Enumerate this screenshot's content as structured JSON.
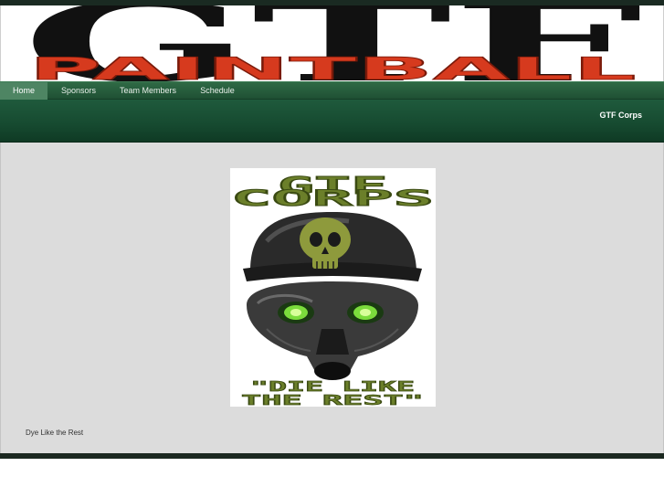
{
  "banner": {
    "title": "GTF",
    "subtitle": "PAINTBALL"
  },
  "nav": {
    "items": [
      {
        "label": "Home",
        "active": true
      },
      {
        "label": "Sponsors",
        "active": false
      },
      {
        "label": "Team Members",
        "active": false
      },
      {
        "label": "Schedule",
        "active": false
      }
    ]
  },
  "header": {
    "site_title": "GTF Corps"
  },
  "poster": {
    "line1": "GTF",
    "line2": "CORPS",
    "slogan_line1": "\"DIE LIKE",
    "slogan_line2": "THE REST\""
  },
  "content": {
    "caption": "Dye Like the Rest"
  },
  "colors": {
    "nav_green": "#2f6a45",
    "header_green": "#164a30",
    "poster_green": "#6b7f2a",
    "banner_red": "#d63a1e"
  }
}
